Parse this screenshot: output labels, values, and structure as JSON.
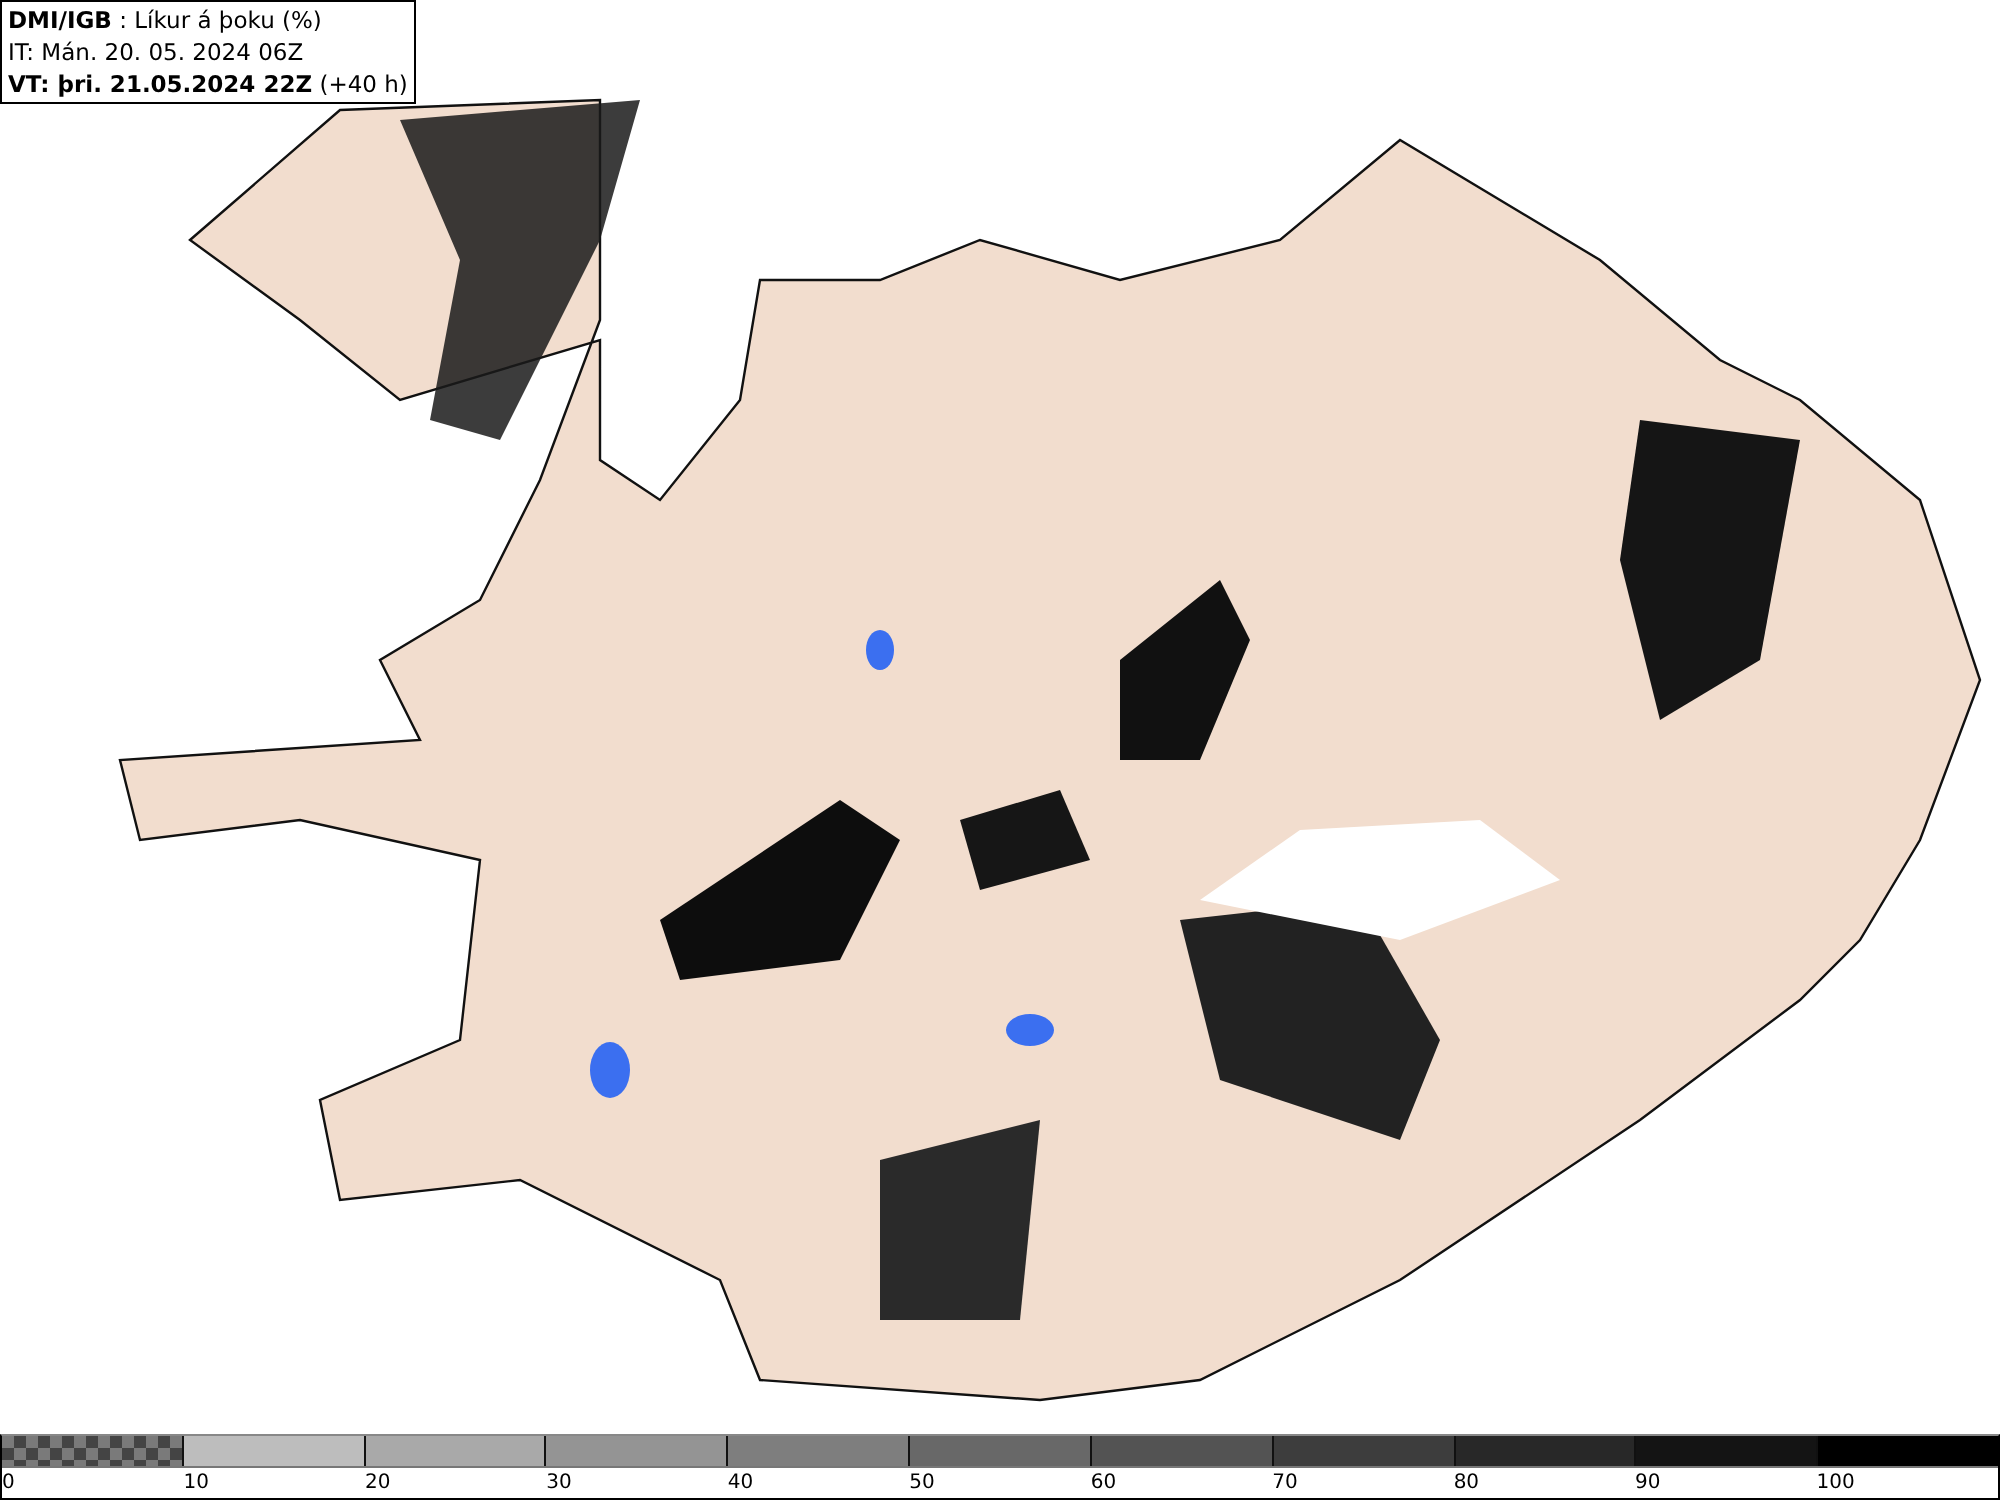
{
  "title_box": {
    "lines": [
      "**DMI/IGB** : Líkur á þoku (%)",
      "IT: Mán. 20. 05. 2024 06Z",
      "**VT: þri. 21.05.2024 22Z** (+40 h)"
    ]
  },
  "legend": {
    "segments": [
      {
        "kind": "checker",
        "color": "#7a7a7a"
      },
      {
        "kind": "solid",
        "color": "#bdbdbd"
      },
      {
        "kind": "solid",
        "color": "#a9a9a9"
      },
      {
        "kind": "solid",
        "color": "#949494"
      },
      {
        "kind": "solid",
        "color": "#7e7e7e"
      },
      {
        "kind": "solid",
        "color": "#686868"
      },
      {
        "kind": "solid",
        "color": "#535353"
      },
      {
        "kind": "solid",
        "color": "#3d3d3d"
      },
      {
        "kind": "solid",
        "color": "#282828"
      },
      {
        "kind": "solid",
        "color": "#141414"
      },
      {
        "kind": "solid",
        "color": "#000000"
      }
    ],
    "labels": [
      "0",
      "10",
      "20",
      "30",
      "40",
      "50",
      "60",
      "70",
      "80",
      "90",
      "100"
    ]
  }
}
